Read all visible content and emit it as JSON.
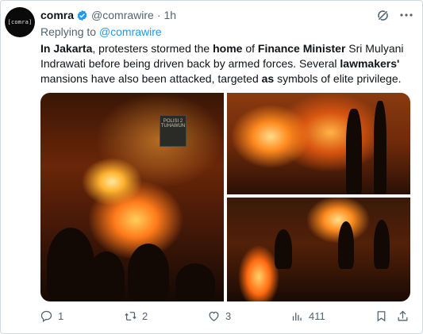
{
  "author": {
    "display_name": "comra",
    "handle": "@comrawire",
    "avatar_text": "[comra]",
    "time": "1h",
    "verified": true
  },
  "reply": {
    "prefix": "Replying to",
    "to": "@comrawire"
  },
  "tweet": {
    "segments": [
      {
        "text": "In Jakarta",
        "bold": true
      },
      {
        "text": ", protesters stormed the ",
        "bold": false
      },
      {
        "text": "home",
        "bold": true
      },
      {
        "text": " of ",
        "bold": false
      },
      {
        "text": "Finance Minister",
        "bold": true
      },
      {
        "text": " Sri Mulyani Indrawati before being driven back by armed forces. Several ",
        "bold": false
      },
      {
        "text": "lawmakers'",
        "bold": true
      },
      {
        "text": " mansions have also been attacked, targeted ",
        "bold": false
      },
      {
        "text": "as",
        "bold": true
      },
      {
        "text": " symbols of elite privilege.",
        "bold": false
      }
    ]
  },
  "media": {
    "photos": [
      {
        "name": "riot-fire-barricade-photo",
        "sign_text": "POLISI 2 TUHAWUN"
      },
      {
        "name": "burning-building-photo"
      },
      {
        "name": "street-fire-protesters-photo"
      }
    ]
  },
  "actions": {
    "replies": "1",
    "reposts": "2",
    "likes": "3",
    "views": "411"
  },
  "icons": [
    "grok-icon",
    "more-icon",
    "reply-icon",
    "repost-icon",
    "like-icon",
    "views-icon",
    "bookmark-icon",
    "share-icon",
    "verified-badge-icon"
  ],
  "colors": {
    "accent": "#1d9bf0",
    "muted": "#536471",
    "text": "#0f1419"
  }
}
